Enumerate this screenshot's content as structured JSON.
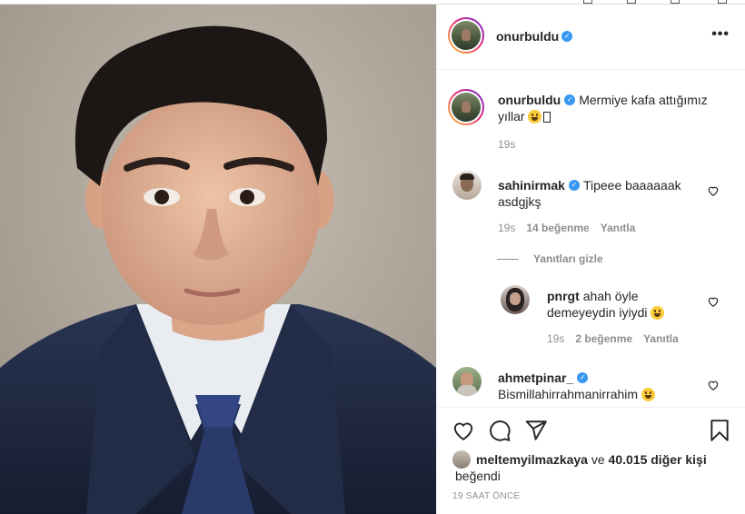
{
  "post": {
    "author": "onurbuldu",
    "caption": "Mermiye kafa attığımız yıllar",
    "caption_time": "19s"
  },
  "icons": {
    "verified": "verified-badge-icon",
    "more": "more-options-icon",
    "like": "heart-icon",
    "comment": "comment-icon",
    "share": "paper-plane-icon",
    "save": "bookmark-icon"
  },
  "comments": [
    {
      "username": "sahinirmak",
      "verified": true,
      "text": "Tipeee baaaaaak asdgjkş",
      "time": "19s",
      "likes": "14 beğenme",
      "reply_label": "Yanıtla"
    },
    {
      "username": "pnrgt",
      "verified": false,
      "text": "ahah öyle demeyeydin iyiydi",
      "time": "19s",
      "likes": "2 beğenme",
      "reply_label": "Yanıtla",
      "is_reply": true
    },
    {
      "username": "ahmetpinar_",
      "verified": true,
      "text": "Bismillahirrahmanirrahim",
      "is_partial": true
    }
  ],
  "hide_replies_label": "Yanıtları gizle",
  "liked_by": {
    "user": "meltemyilmazkaya",
    "connector": "ve",
    "others": "40.015 diğer kişi",
    "suffix": "beğendi"
  },
  "time_ago": "19 SAAT ÖNCE",
  "colors": {
    "verified_blue": "#3897f0",
    "text": "#262626",
    "muted": "#8e8e8e",
    "border": "#efefef"
  }
}
